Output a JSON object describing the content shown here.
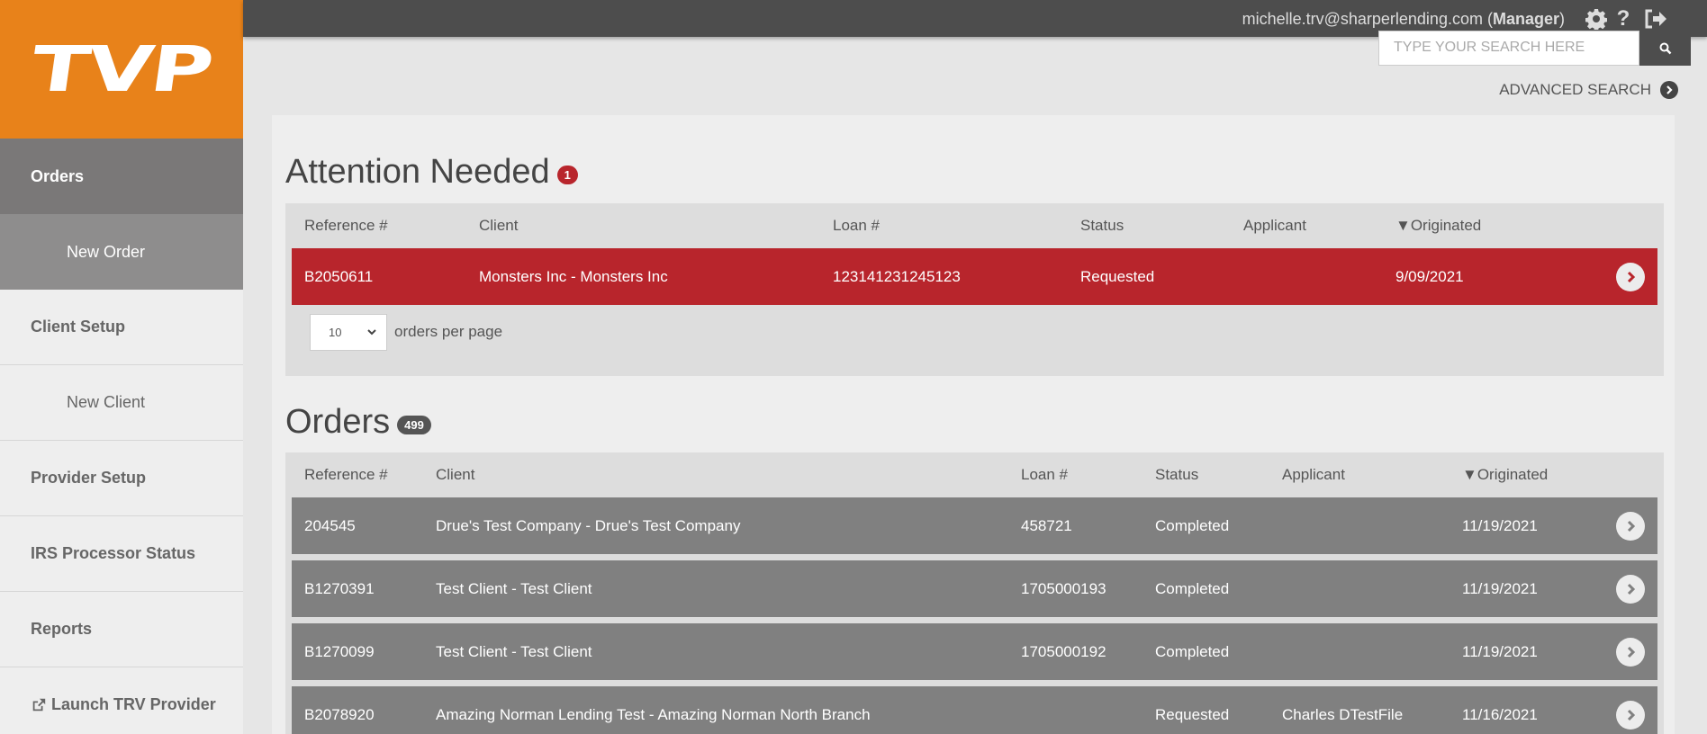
{
  "brand": {
    "logo_text": "TVP",
    "accent": "#e8821a"
  },
  "sidebar": {
    "items": [
      {
        "label": "Orders"
      },
      {
        "label": "New Order"
      },
      {
        "label": "Client Setup"
      },
      {
        "label": "New Client"
      },
      {
        "label": "Provider Setup"
      },
      {
        "label": "IRS Processor Status"
      },
      {
        "label": "Reports"
      },
      {
        "label": "Launch TRV Provider",
        "icon": "external-link-icon"
      }
    ]
  },
  "topbar": {
    "email": "michelle.trv@sharperlending.com",
    "role": "Manager",
    "icons": [
      "gear-icon",
      "help-icon",
      "logout-icon"
    ]
  },
  "search": {
    "placeholder": "TYPE YOUR SEARCH HERE",
    "advanced_label": "ADVANCED SEARCH"
  },
  "attention": {
    "title": "Attention Needed",
    "count": "1",
    "headers": [
      "Reference #",
      "Client",
      "Loan #",
      "Status",
      "Applicant",
      "▼Originated"
    ],
    "rows": [
      [
        "B2050611",
        "Monsters Inc - Monsters Inc",
        "123141231245123",
        "Requested",
        "",
        "9/09/2021"
      ]
    ],
    "per_page_value": "10",
    "per_page_label": "orders per page"
  },
  "orders": {
    "title": "Orders",
    "count": "499",
    "headers": [
      "Reference #",
      "Client",
      "Loan #",
      "Status",
      "Applicant",
      "▼Originated"
    ],
    "rows": [
      [
        "204545",
        "Drue's Test Company - Drue's Test Company",
        "458721",
        "Completed",
        "",
        "11/19/2021"
      ],
      [
        "B1270391",
        "Test Client - Test Client",
        "1705000193",
        "Completed",
        "",
        "11/19/2021"
      ],
      [
        "B1270099",
        "Test Client - Test Client",
        "1705000192",
        "Completed",
        "",
        "11/19/2021"
      ],
      [
        "B2078920",
        "Amazing Norman Lending Test - Amazing Norman North Branch",
        "",
        "Requested",
        "Charles DTestFile",
        "11/16/2021"
      ]
    ]
  },
  "colors": {
    "alert_row": "#b8252c",
    "normal_row": "#808080",
    "topbar": "#4d4d4d"
  }
}
